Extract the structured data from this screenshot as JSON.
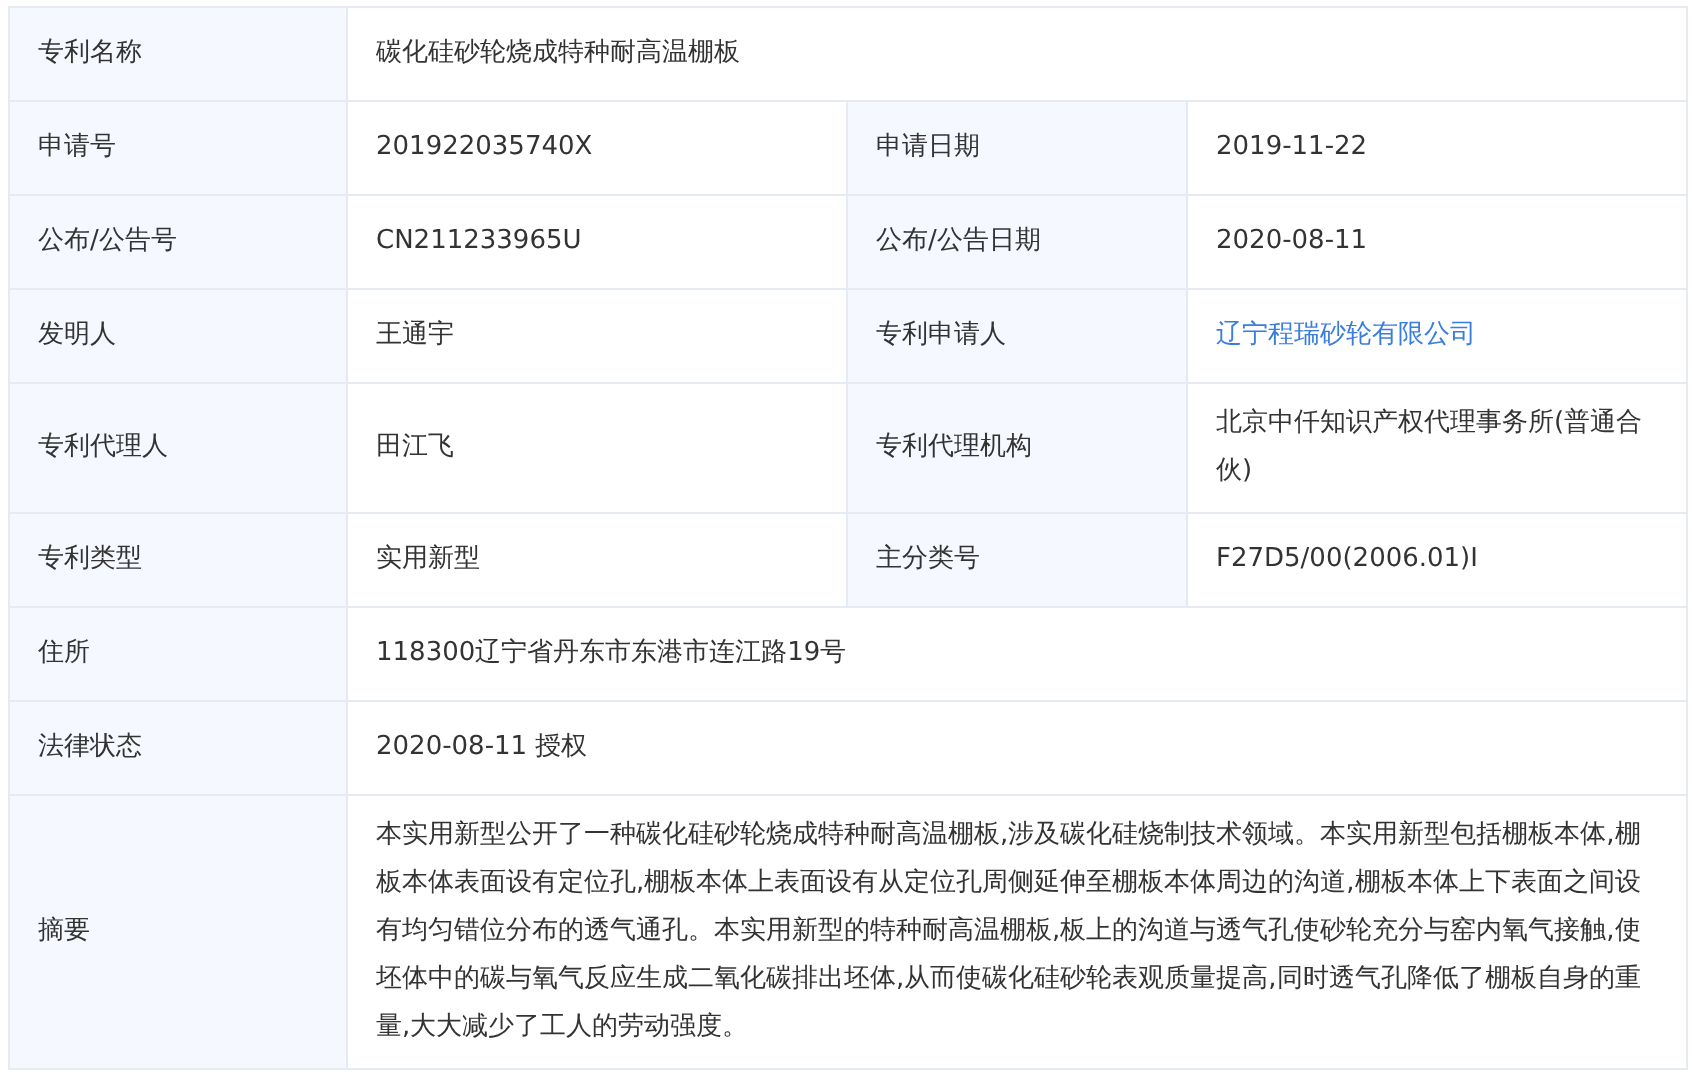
{
  "rows": [
    {
      "fields": [
        {
          "label": "专利名称",
          "value": "碳化硅砂轮烧成特种耐高温棚板"
        }
      ]
    },
    {
      "fields": [
        {
          "label": "申请号",
          "value": "201922035740X"
        },
        {
          "label": "申请日期",
          "value": "2019-11-22"
        }
      ]
    },
    {
      "fields": [
        {
          "label": "公布/公告号",
          "value": "CN211233965U"
        },
        {
          "label": "公布/公告日期",
          "value": "2020-08-11"
        }
      ]
    },
    {
      "fields": [
        {
          "label": "发明人",
          "value": "王通宇"
        },
        {
          "label": "专利申请人",
          "value": "辽宁程瑞砂轮有限公司",
          "kind": "link"
        }
      ]
    },
    {
      "fields": [
        {
          "label": "专利代理人",
          "value": "田江飞"
        },
        {
          "label": "专利代理机构",
          "value": "北京中仟知识产权代理事务所(普通合伙)"
        }
      ]
    },
    {
      "fields": [
        {
          "label": "专利类型",
          "value": "实用新型"
        },
        {
          "label": "主分类号",
          "value": "F27D5/00(2006.01)I"
        }
      ]
    },
    {
      "fields": [
        {
          "label": "住所",
          "value": "118300辽宁省丹东市东港市连江路19号"
        }
      ]
    },
    {
      "fields": [
        {
          "label": "法律状态",
          "value": "2020-08-11 授权"
        }
      ]
    },
    {
      "fields": [
        {
          "label": "摘要",
          "value": "本实用新型公开了一种碳化硅砂轮烧成特种耐高温棚板,涉及碳化硅烧制技术领域。本实用新型包括棚板本体,棚板本体表面设有定位孔,棚板本体上表面设有从定位孔周侧延伸至棚板本体周边的沟道,棚板本体上下表面之间设有均匀错位分布的透气通孔。本实用新型的特种耐高温棚板,板上的沟道与透气孔使砂轮充分与窑内氧气接触,使坯体中的碳与氧气反应生成二氧化碳排出坯体,从而使碳化硅砂轮表观质量提高,同时透气孔降低了棚板自身的重量,大大减少了工人的劳动强度。"
        }
      ]
    }
  ]
}
